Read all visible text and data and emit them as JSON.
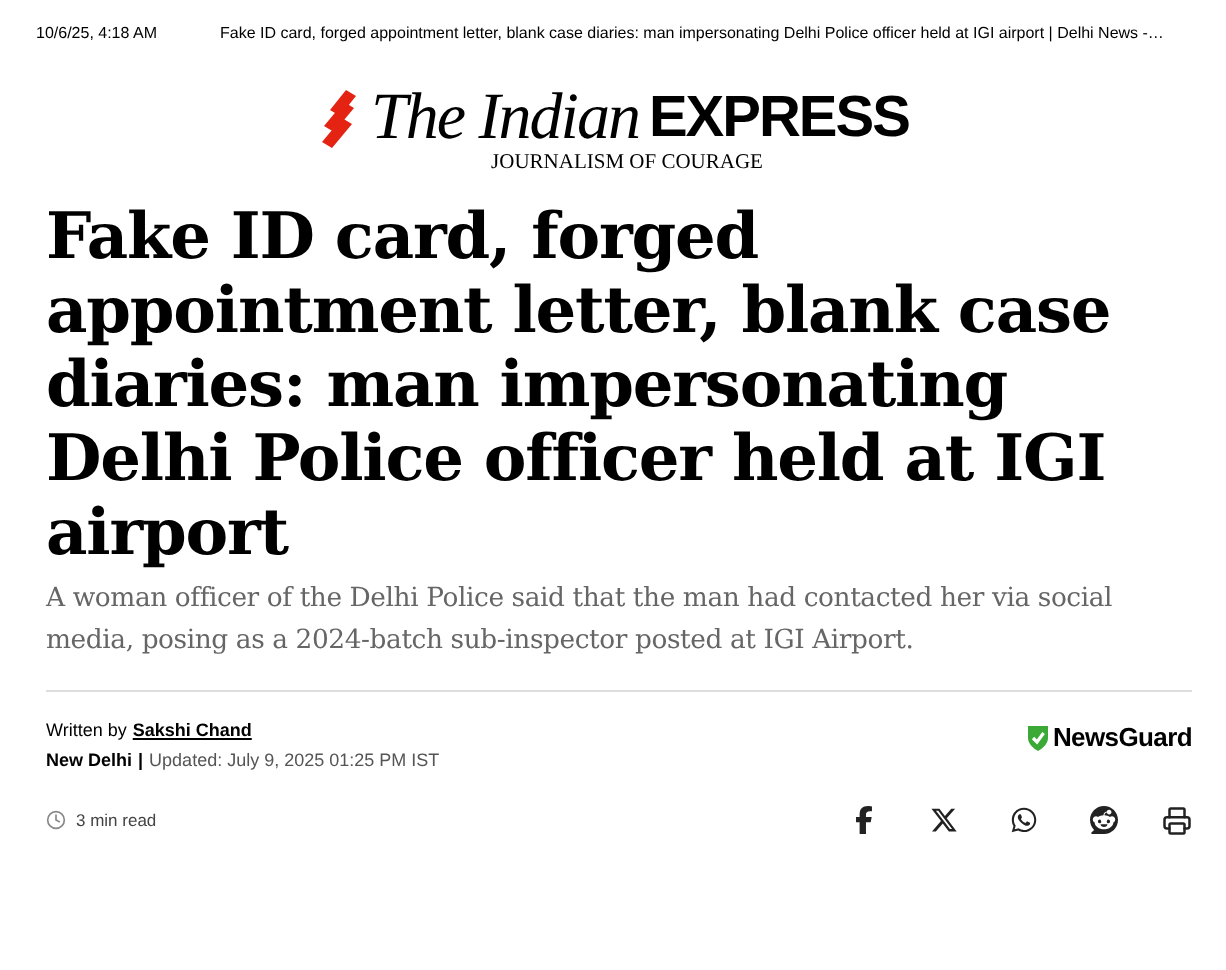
{
  "print_header": {
    "date": "10/6/25, 4:18 AM",
    "page_title": "Fake ID card, forged appointment letter, blank case diaries: man impersonating Delhi Police officer held at IGI airport | Delhi News -…"
  },
  "logo": {
    "wordmark_italic": "The Indian",
    "wordmark_bold": "EXPRESS",
    "tagline": "JOURNALISM OF COURAGE"
  },
  "article": {
    "headline": "Fake ID card, forged appointment letter, blank case diaries: man impersonating Delhi Police officer held at IGI airport",
    "summary": "A woman officer of the Delhi Police said that the man had contacted her via social media, posing as a 2024-batch sub-inspector posted at IGI Airport.",
    "written_by_label": "Written by",
    "author": "Sakshi Chand",
    "location": "New Delhi",
    "separator": "|",
    "updated": "Updated: July 9, 2025 01:25 PM IST",
    "badge": "NewsGuard",
    "read_time": "3 min read",
    "share_buttons": [
      {
        "kind": "facebook"
      },
      {
        "kind": "x"
      },
      {
        "kind": "whatsapp"
      },
      {
        "kind": "reddit"
      }
    ]
  }
}
